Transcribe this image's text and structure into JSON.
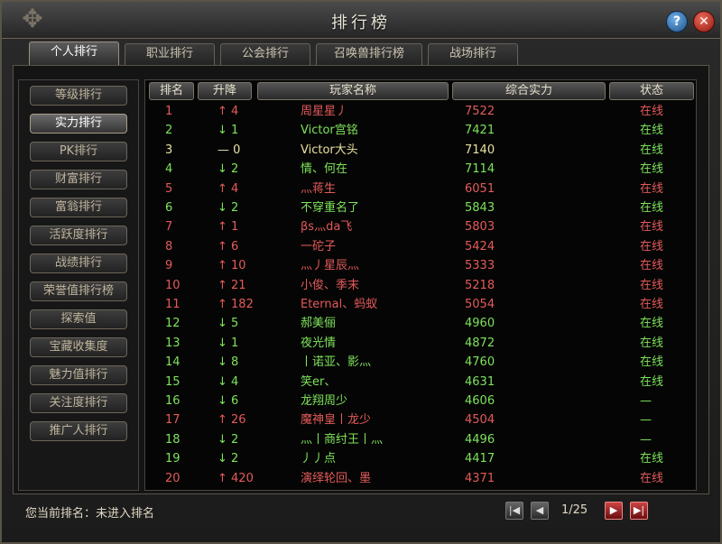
{
  "window": {
    "title": "排行榜"
  },
  "tabs": [
    {
      "label": "个人排行",
      "active": true
    },
    {
      "label": "职业排行",
      "active": false
    },
    {
      "label": "公会排行",
      "active": false
    },
    {
      "label": "召唤兽排行榜",
      "active": false
    },
    {
      "label": "战场排行",
      "active": false
    }
  ],
  "sidebar": [
    {
      "label": "等级排行",
      "active": false
    },
    {
      "label": "实力排行",
      "active": true
    },
    {
      "label": "PK排行",
      "active": false
    },
    {
      "label": "财富排行",
      "active": false
    },
    {
      "label": "富翁排行",
      "active": false
    },
    {
      "label": "活跃度排行",
      "active": false
    },
    {
      "label": "战绩排行",
      "active": false
    },
    {
      "label": "荣誉值排行榜",
      "active": false
    },
    {
      "label": "探索值",
      "active": false
    },
    {
      "label": "宝藏收集度",
      "active": false
    },
    {
      "label": "魅力值排行",
      "active": false
    },
    {
      "label": "关注度排行",
      "active": false
    },
    {
      "label": "推广人排行",
      "active": false
    }
  ],
  "table": {
    "headers": [
      "排名",
      "升降",
      "玩家名称",
      "综合实力",
      "状态"
    ],
    "rows": [
      {
        "rank": "1",
        "change": "↑ 4",
        "dir": "up",
        "name": "周星星丿",
        "power": "7522",
        "status": "在线"
      },
      {
        "rank": "2",
        "change": "↓ 1",
        "dir": "down",
        "name": "Victor宫铭",
        "power": "7421",
        "status": "在线"
      },
      {
        "rank": "3",
        "change": "— 0",
        "dir": "same",
        "name": "Victor大头",
        "power": "7140",
        "status": "在线"
      },
      {
        "rank": "4",
        "change": "↓ 2",
        "dir": "down",
        "name": "情、何在",
        "power": "7114",
        "status": "在线"
      },
      {
        "rank": "5",
        "change": "↑ 4",
        "dir": "up",
        "name": "灬蒋生",
        "power": "6051",
        "status": "在线"
      },
      {
        "rank": "6",
        "change": "↓ 2",
        "dir": "down",
        "name": "不穿重名了",
        "power": "5843",
        "status": "在线"
      },
      {
        "rank": "7",
        "change": "↑ 1",
        "dir": "up",
        "name": "βs灬da飞",
        "power": "5803",
        "status": "在线"
      },
      {
        "rank": "8",
        "change": "↑ 6",
        "dir": "up",
        "name": "一砣子",
        "power": "5424",
        "status": "在线"
      },
      {
        "rank": "9",
        "change": "↑ 10",
        "dir": "up",
        "name": "灬丿星辰灬",
        "power": "5333",
        "status": "在线"
      },
      {
        "rank": "10",
        "change": "↑ 21",
        "dir": "up",
        "name": "小俊、季末",
        "power": "5218",
        "status": "在线"
      },
      {
        "rank": "11",
        "change": "↑ 182",
        "dir": "up",
        "name": "Eternal、蚂蚁",
        "power": "5054",
        "status": "在线"
      },
      {
        "rank": "12",
        "change": "↓ 5",
        "dir": "down",
        "name": "郝美俪",
        "power": "4960",
        "status": "在线"
      },
      {
        "rank": "13",
        "change": "↓ 1",
        "dir": "down",
        "name": "夜光情",
        "power": "4872",
        "status": "在线"
      },
      {
        "rank": "14",
        "change": "↓ 8",
        "dir": "down",
        "name": "丨诺亚、影灬",
        "power": "4760",
        "status": "在线"
      },
      {
        "rank": "15",
        "change": "↓ 4",
        "dir": "down",
        "name": "笑er、",
        "power": "4631",
        "status": "在线"
      },
      {
        "rank": "16",
        "change": "↓ 6",
        "dir": "down",
        "name": "龙翔周少",
        "power": "4606",
        "status": "—"
      },
      {
        "rank": "17",
        "change": "↑ 26",
        "dir": "up",
        "name": "魔神皇丨龙少",
        "power": "4504",
        "status": "—"
      },
      {
        "rank": "18",
        "change": "↓ 2",
        "dir": "down",
        "name": "灬丨商纣王丨灬",
        "power": "4496",
        "status": "—"
      },
      {
        "rank": "19",
        "change": "↓ 2",
        "dir": "down",
        "name": "丿丿点",
        "power": "4417",
        "status": "在线"
      },
      {
        "rank": "20",
        "change": "↑ 420",
        "dir": "up",
        "name": "演绎轮回、墨",
        "power": "4371",
        "status": "在线"
      }
    ]
  },
  "footer": {
    "current_rank_label": "您当前排名：未进入排名",
    "page": "1/25"
  },
  "icons": {
    "help": "question-icon",
    "close": "close-icon",
    "first": "first-page-icon",
    "prev": "prev-page-icon",
    "next": "next-page-icon",
    "last": "last-page-icon"
  },
  "colors": {
    "up": "#e45a5a",
    "down": "#7ee35c",
    "same": "#e8e0a0",
    "online": "#7ee35c"
  }
}
